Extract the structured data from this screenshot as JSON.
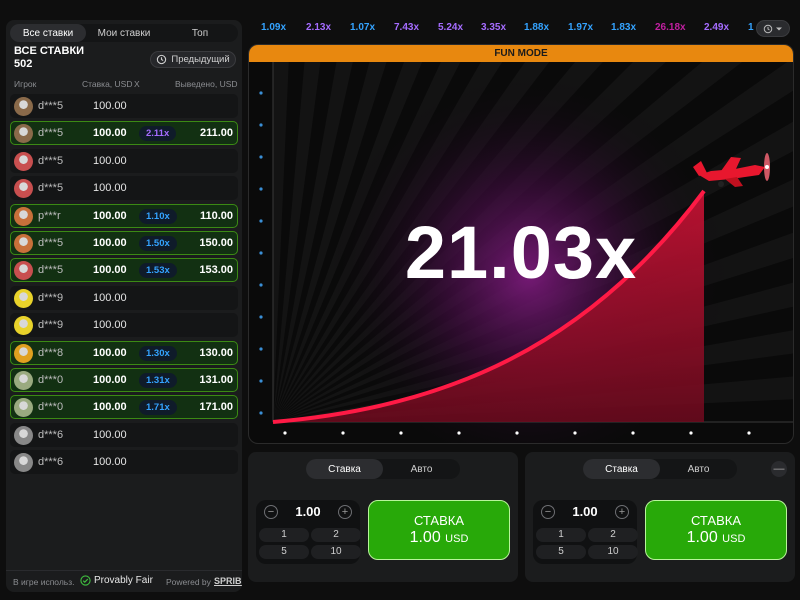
{
  "left_panel": {
    "tabs": [
      "Все ставки",
      "Мои ставки",
      "Топ"
    ],
    "all_bets_label": "ВСЕ СТАВКИ",
    "all_bets_count": "502",
    "previous_button": "Предыдущий",
    "columns": {
      "player": "Игрок",
      "bet": "Ставка, USD",
      "x": "X",
      "cashout": "Выведено, USD"
    },
    "rows": [
      {
        "player": "d***5",
        "bet": "100.00",
        "mult": "",
        "cashout": "",
        "win": false,
        "avatar_color": "#8a6a4a",
        "mult_color": ""
      },
      {
        "player": "d***5",
        "bet": "100.00",
        "mult": "2.11x",
        "cashout": "211.00",
        "win": true,
        "avatar_color": "#8a6a4a",
        "mult_color": "#a56cff"
      },
      {
        "player": "d***5",
        "bet": "100.00",
        "mult": "",
        "cashout": "",
        "win": false,
        "avatar_color": "#c84f4f",
        "mult_color": ""
      },
      {
        "player": "d***5",
        "bet": "100.00",
        "mult": "",
        "cashout": "",
        "win": false,
        "avatar_color": "#c84f4f",
        "mult_color": ""
      },
      {
        "player": "p***r",
        "bet": "100.00",
        "mult": "1.10x",
        "cashout": "110.00",
        "win": true,
        "avatar_color": "#c8703a",
        "mult_color": "#34a3ff"
      },
      {
        "player": "d***5",
        "bet": "100.00",
        "mult": "1.50x",
        "cashout": "150.00",
        "win": true,
        "avatar_color": "#c8703a",
        "mult_color": "#34a3ff"
      },
      {
        "player": "d***5",
        "bet": "100.00",
        "mult": "1.53x",
        "cashout": "153.00",
        "win": true,
        "avatar_color": "#c84f4f",
        "mult_color": "#34a3ff"
      },
      {
        "player": "d***9",
        "bet": "100.00",
        "mult": "",
        "cashout": "",
        "win": false,
        "avatar_color": "#e8d22a",
        "mult_color": ""
      },
      {
        "player": "d***9",
        "bet": "100.00",
        "mult": "",
        "cashout": "",
        "win": false,
        "avatar_color": "#e8d22a",
        "mult_color": ""
      },
      {
        "player": "d***8",
        "bet": "100.00",
        "mult": "1.30x",
        "cashout": "130.00",
        "win": true,
        "avatar_color": "#e0a020",
        "mult_color": "#34a3ff"
      },
      {
        "player": "d***0",
        "bet": "100.00",
        "mult": "1.31x",
        "cashout": "131.00",
        "win": true,
        "avatar_color": "#9aaa80",
        "mult_color": "#34a3ff"
      },
      {
        "player": "d***0",
        "bet": "100.00",
        "mult": "1.71x",
        "cashout": "171.00",
        "win": true,
        "avatar_color": "#9aaa80",
        "mult_color": "#34a3ff"
      },
      {
        "player": "d***6",
        "bet": "100.00",
        "mult": "",
        "cashout": "",
        "win": false,
        "avatar_color": "#888888",
        "mult_color": ""
      },
      {
        "player": "d***6",
        "bet": "100.00",
        "mult": "",
        "cashout": "",
        "win": false,
        "avatar_color": "#888888",
        "mult_color": ""
      }
    ],
    "footer": {
      "in_game": "В игре использ.",
      "provably_fair": "Provably Fair",
      "powered_by": "Powered by",
      "brand": "SPRIBE"
    }
  },
  "history": [
    {
      "value": "1.09x",
      "color": "#34a3ff"
    },
    {
      "value": "2.13x",
      "color": "#a56cff"
    },
    {
      "value": "1.07x",
      "color": "#34a3ff"
    },
    {
      "value": "7.43x",
      "color": "#a56cff"
    },
    {
      "value": "5.24x",
      "color": "#a56cff"
    },
    {
      "value": "3.35x",
      "color": "#a56cff"
    },
    {
      "value": "1.88x",
      "color": "#34a3ff"
    },
    {
      "value": "1.97x",
      "color": "#34a3ff"
    },
    {
      "value": "1.83x",
      "color": "#34a3ff"
    },
    {
      "value": "26.18x",
      "color": "#c020a0"
    },
    {
      "value": "2.49x",
      "color": "#a56cff"
    },
    {
      "value": "1",
      "color": "#34a3ff"
    }
  ],
  "game": {
    "mode_banner": "FUN MODE",
    "multiplier": "21.03x",
    "accent_color": "#e51b3d"
  },
  "bet_panels": [
    {
      "tabs": [
        "Ставка",
        "Авто"
      ],
      "stake": "1.00",
      "quick_amounts": [
        "1",
        "2",
        "5",
        "10"
      ],
      "bet_label": "СТАВКА",
      "bet_amount": "1.00",
      "currency": "USD"
    },
    {
      "tabs": [
        "Ставка",
        "Авто"
      ],
      "stake": "1.00",
      "quick_amounts": [
        "1",
        "2",
        "5",
        "10"
      ],
      "bet_label": "СТАВКА",
      "bet_amount": "1.00",
      "currency": "USD"
    }
  ]
}
